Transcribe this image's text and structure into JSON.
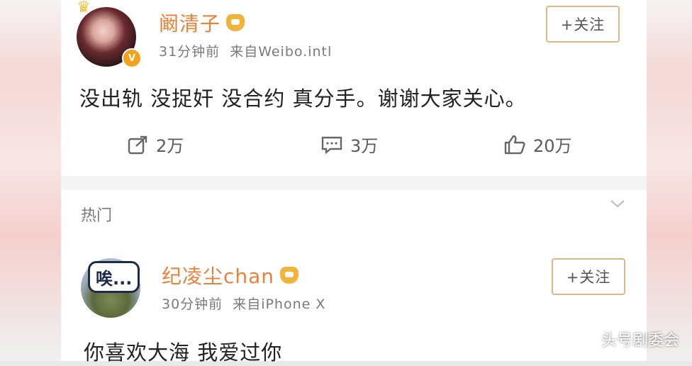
{
  "post": {
    "username": "阚清子",
    "time": "31分钟前",
    "source": "来自Weibo.intl",
    "follow_label": "+关注",
    "content": "没出轨 没捉奸 没合约 真分手。谢谢大家关心。",
    "actions": {
      "repost": "2万",
      "comment": "3万",
      "like": "20万"
    }
  },
  "hot_section": {
    "label": "热门"
  },
  "comment": {
    "avatar_text": "唉...",
    "username": "纪凌尘chan",
    "time": "30分钟前",
    "source": "来自iPhone X",
    "follow_label": "+关注",
    "content": "你喜欢大海 我爱过你"
  },
  "watermark": "头号剧委会",
  "icons": [
    "repost-icon",
    "comment-icon",
    "like-icon",
    "chevron-down-icon",
    "verified-icon",
    "crown-icon",
    "vip-icon"
  ],
  "colors": {
    "username": "#e8813a",
    "follow_border": "#d8b98a",
    "vip": "#f2b33a"
  }
}
